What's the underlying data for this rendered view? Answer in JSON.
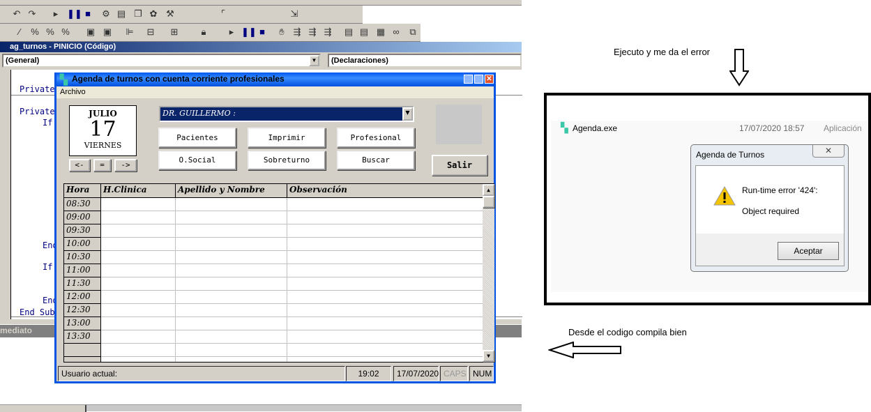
{
  "ide": {
    "code_window_title": "ag_turnos - PINICIO (Código)",
    "object_combo": "(General)",
    "proc_combo": "(Declaraciones)",
    "code_lines": [
      "Private",
      "Private",
      "If",
      "End",
      "If",
      "End",
      "End Sub"
    ],
    "immediate_label": "mediato"
  },
  "form": {
    "title": "Agenda de turnos con cuenta corriente profesionales",
    "menu": [
      "Archivo"
    ],
    "calendar": {
      "month": "JULIO",
      "day": "17",
      "weekday": "VIERNES"
    },
    "nav": [
      "<-",
      "=",
      "->"
    ],
    "doctor_combo": "DR. GUILLERMO :",
    "buttons": [
      "Pacientes",
      "Imprimir",
      "Profesional",
      "O.Social",
      "Sobreturno",
      "Buscar"
    ],
    "exit_button": "Salir",
    "grid": {
      "columns": [
        "Hora",
        "H.Clinica",
        "Apellido y Nombre",
        "Observación"
      ],
      "hours": [
        "08:30",
        "09:00",
        "09:30",
        "10:00",
        "10:30",
        "11:00",
        "11:30",
        "12:00",
        "12:30",
        "13:00",
        "13:30",
        "",
        ""
      ]
    },
    "status": {
      "user": "Usuario actual:",
      "time": "19:02",
      "date": "17/07/2020",
      "caps": "CAPS",
      "num": "NUM"
    }
  },
  "explorer": {
    "file": "Agenda.exe",
    "modified": "17/07/2020 18:57",
    "type": "Aplicación"
  },
  "dialog": {
    "title": "Agenda de Turnos",
    "error": "Run-time error '424':",
    "message": "Object required",
    "ok": "Aceptar"
  },
  "notes": {
    "top": "Ejecuto y me da el error",
    "bottom": "Desde el codigo compila bien"
  },
  "colors": {
    "title_blue": "#0054e3",
    "combo_navy": "#0a246a",
    "tooth": "#3cc8a8"
  }
}
